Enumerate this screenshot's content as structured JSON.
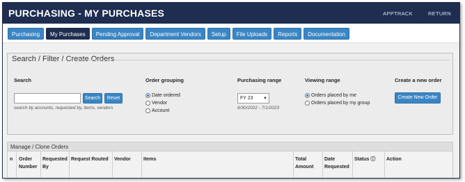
{
  "header": {
    "title": "PURCHASING - MY PURCHASES",
    "links": [
      "APPTRACK",
      "RETURN"
    ]
  },
  "nav": {
    "tabs": [
      "Purchasing",
      "My Purchases",
      "Pending Approval",
      "Department Vendors",
      "Setup",
      "File Uploads",
      "Reports",
      "Documentation"
    ],
    "active": "My Purchases"
  },
  "search_panel": {
    "legend": "Search / Filter / Create Orders",
    "search": {
      "label": "Search",
      "value": "",
      "placeholder": "",
      "hint": "search by accounts, requested by, items, vendors",
      "search_button": "Search",
      "reset_button": "Reset"
    },
    "order_grouping": {
      "label": "Order grouping",
      "options": [
        "Date ordered",
        "Vendor",
        "Account"
      ],
      "selected": "Date ordered"
    },
    "purchasing_range": {
      "label": "Purchasing range",
      "selected": "FY 23",
      "dates": "6/30/2022 - 7/1/2023"
    },
    "viewing_range": {
      "label": "Viewing range",
      "options": [
        "Orders placed by me",
        "Orders placed by my group"
      ],
      "selected": "Orders placed by me"
    },
    "create": {
      "label": "Create a new order",
      "button": "Create New Order"
    }
  },
  "manage": {
    "title": "Manage / Clone Orders",
    "columns": [
      "n",
      "Order Number",
      "Requested By",
      "Request Routed",
      "Vendor",
      "Items",
      "Total Amount",
      "Date Requested",
      "Status ⓘ",
      "Action"
    ]
  }
}
